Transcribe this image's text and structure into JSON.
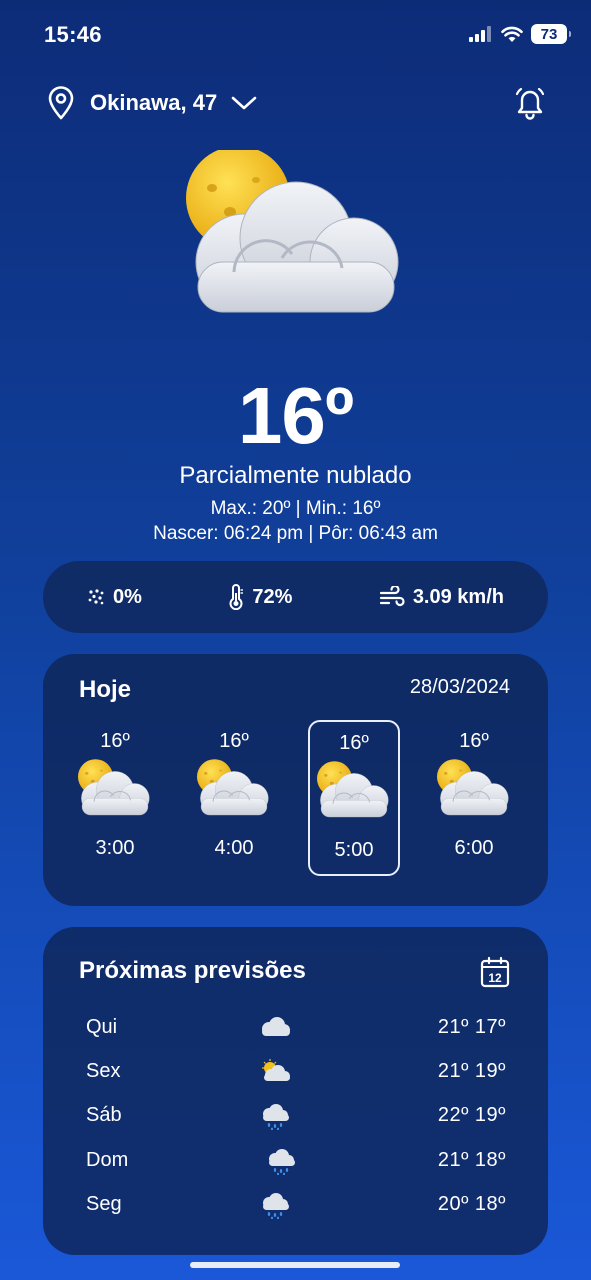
{
  "status": {
    "time": "15:46",
    "battery": "73"
  },
  "header": {
    "location": "Okinawa, 47"
  },
  "current": {
    "temperature": "16º",
    "condition": "Parcialmente nublado",
    "minmax": "Max.: 20º | Min.: 16º",
    "sun": "Nascer: 06:24 pm | Pôr: 06:43 am",
    "icon": "partly-cloudy-icon"
  },
  "stats": {
    "rain": "0%",
    "humidity": "72%",
    "wind": "3.09 km/h"
  },
  "today": {
    "title": "Hoje",
    "date": "28/03/2024",
    "hours": [
      {
        "temp": "16º",
        "time": "3:00",
        "icon": "partly-cloudy-icon"
      },
      {
        "temp": "16º",
        "time": "4:00",
        "icon": "partly-cloudy-icon"
      },
      {
        "temp": "16º",
        "time": "5:00",
        "icon": "partly-cloudy-icon",
        "selected": true
      },
      {
        "temp": "16º",
        "time": "6:00",
        "icon": "partly-cloudy-icon"
      }
    ]
  },
  "forecast": {
    "title": "Próximas previsões",
    "days": [
      {
        "day": "Qui",
        "icon": "cloud-icon",
        "temps": "21º 17º"
      },
      {
        "day": "Sex",
        "icon": "sun-cloud-icon",
        "temps": "21º 19º"
      },
      {
        "day": "Sáb",
        "icon": "rain-icon",
        "temps": "22º 19º"
      },
      {
        "day": "Dom",
        "icon": "rain-icon",
        "temps": "21º 18º"
      },
      {
        "day": "Seg",
        "icon": "rain-icon",
        "temps": "20º 18º"
      }
    ]
  },
  "colors": {
    "background_top": "#0d2c78",
    "background_bottom": "#1a58d8",
    "card": "#0f2658",
    "sun": "#f2c11b",
    "cloud": "#dfe3ea",
    "rain": "#3f8fe6"
  }
}
